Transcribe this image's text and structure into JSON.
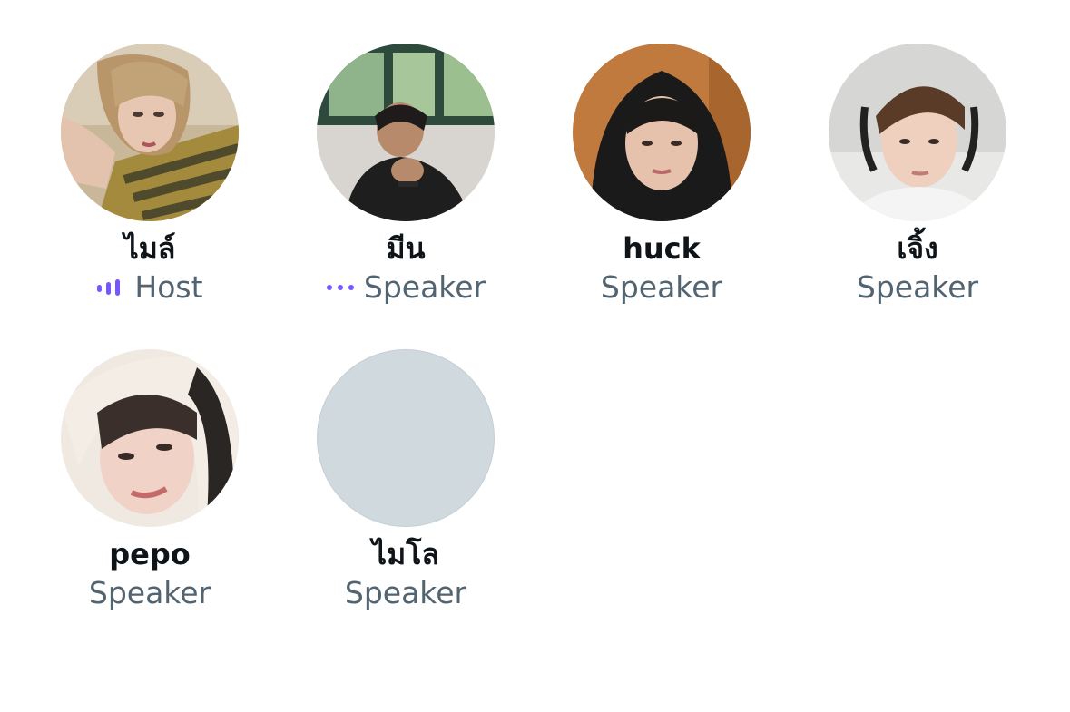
{
  "accent_color": "#7856ff",
  "participants": [
    {
      "name": "ไมล์",
      "role": "Host",
      "indicator": "speaking-bars-icon"
    },
    {
      "name": "มีน",
      "role": "Speaker",
      "indicator": "connecting-dots-icon"
    },
    {
      "name": "huck",
      "role": "Speaker"
    },
    {
      "name": "เจิ้ง",
      "role": "Speaker"
    },
    {
      "name": "pepo",
      "role": "Speaker"
    },
    {
      "name": "ไมโล",
      "role": "Speaker"
    }
  ]
}
